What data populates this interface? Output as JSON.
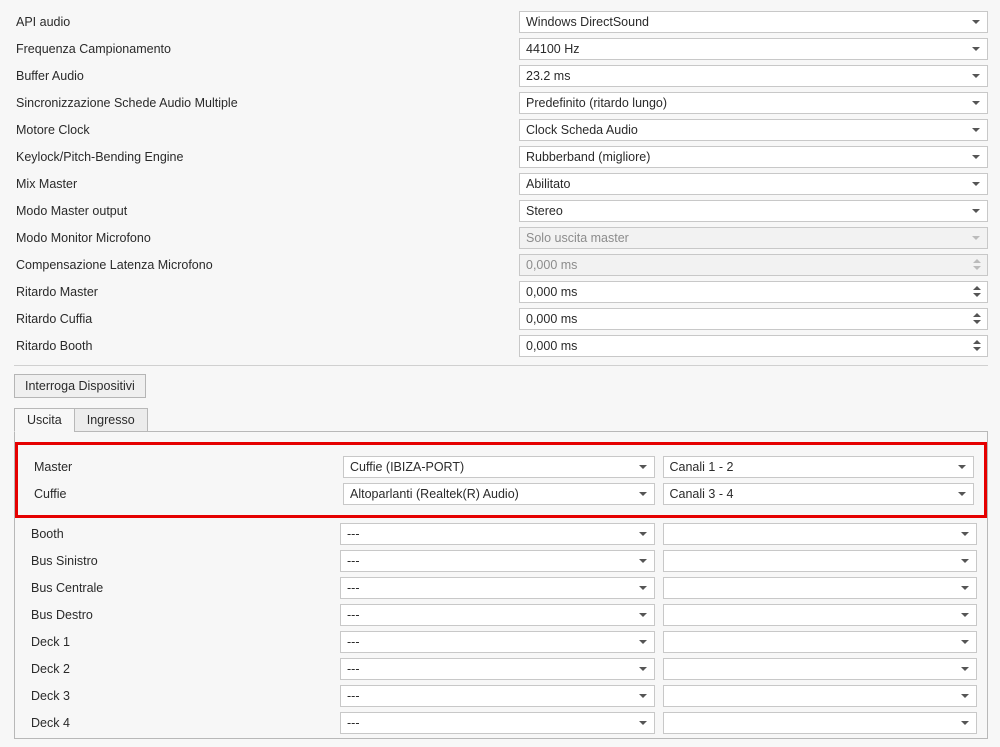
{
  "settings": [
    {
      "label": "API audio",
      "value": "Windows DirectSound",
      "type": "select"
    },
    {
      "label": "Frequenza Campionamento",
      "value": "44100 Hz",
      "type": "select"
    },
    {
      "label": "Buffer Audio",
      "value": "23.2 ms",
      "type": "select"
    },
    {
      "label": "Sincronizzazione Schede Audio Multiple",
      "value": "Predefinito (ritardo lungo)",
      "type": "select"
    },
    {
      "label": "Motore Clock",
      "value": "Clock Scheda Audio",
      "type": "select"
    },
    {
      "label": "Keylock/Pitch-Bending Engine",
      "value": "Rubberband (migliore)",
      "type": "select"
    },
    {
      "label": "Mix Master",
      "value": "Abilitato",
      "type": "select"
    },
    {
      "label": "Modo Master output",
      "value": "Stereo",
      "type": "select"
    },
    {
      "label": "Modo Monitor Microfono",
      "value": "Solo uscita master",
      "type": "select",
      "disabled": true
    },
    {
      "label": "Compensazione Latenza Microfono",
      "value": "0,000 ms",
      "type": "numeric",
      "disabled": true
    },
    {
      "label": "Ritardo Master",
      "value": "0,000 ms",
      "type": "numeric"
    },
    {
      "label": "Ritardo Cuffia",
      "value": "0,000 ms",
      "type": "numeric"
    },
    {
      "label": "Ritardo Booth",
      "value": "0,000 ms",
      "type": "numeric"
    }
  ],
  "button_query": "Interroga Dispositivi",
  "tabs": {
    "active": "Uscita",
    "inactive": "Ingresso"
  },
  "routing_highlight": [
    {
      "label": "Master",
      "device": "Cuffie (IBIZA-PORT)",
      "channels": "Canali 1 - 2"
    },
    {
      "label": "Cuffie",
      "device": "Altoparlanti (Realtek(R) Audio)",
      "channels": "Canali 3 - 4"
    }
  ],
  "routing_rest": [
    {
      "label": "Booth",
      "device": "---",
      "channels": ""
    },
    {
      "label": "Bus Sinistro",
      "device": "---",
      "channels": ""
    },
    {
      "label": "Bus Centrale",
      "device": "---",
      "channels": ""
    },
    {
      "label": "Bus Destro",
      "device": "---",
      "channels": ""
    },
    {
      "label": "Deck 1",
      "device": "---",
      "channels": ""
    },
    {
      "label": "Deck 2",
      "device": "---",
      "channels": ""
    },
    {
      "label": "Deck 3",
      "device": "---",
      "channels": ""
    },
    {
      "label": "Deck 4",
      "device": "---",
      "channels": ""
    }
  ]
}
